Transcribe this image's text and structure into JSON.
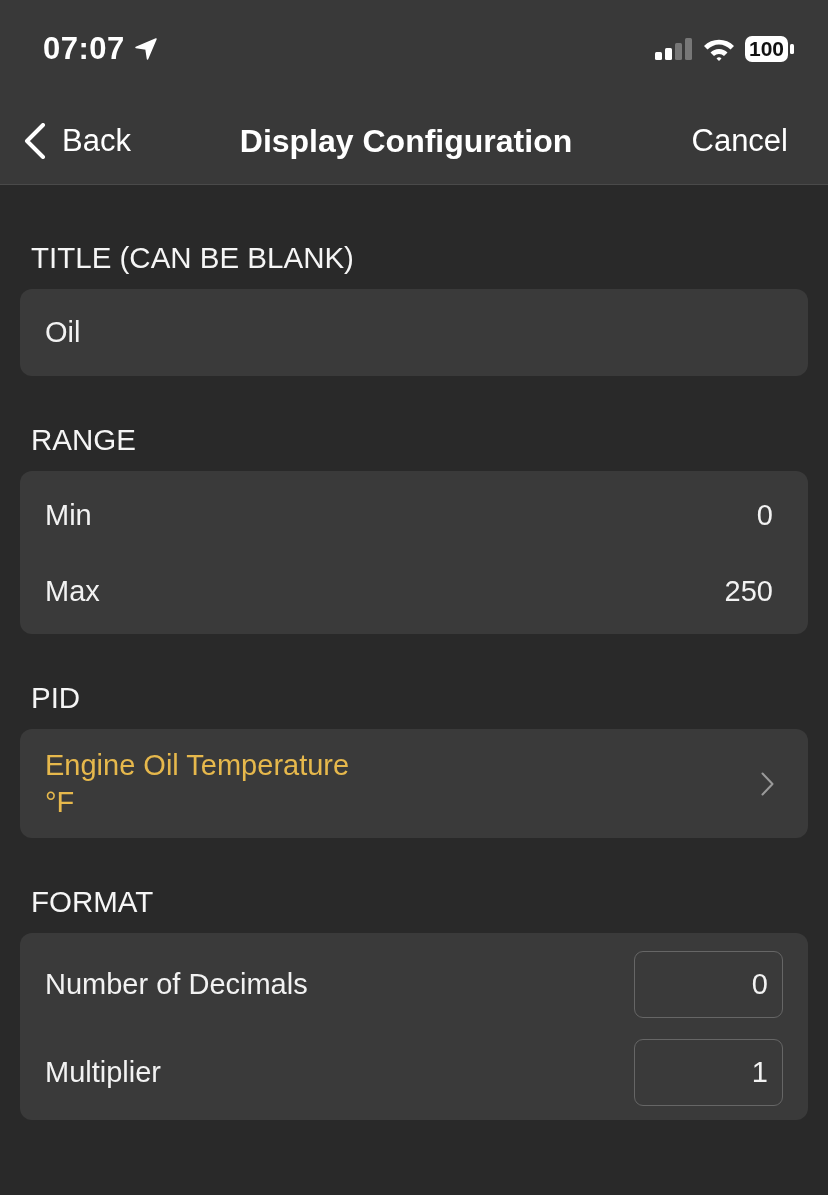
{
  "status_bar": {
    "time": "07:07",
    "battery": "100"
  },
  "nav": {
    "back": "Back",
    "title": "Display Configuration",
    "cancel": "Cancel"
  },
  "sections": [
    {
      "header": "TITLE (CAN BE BLANK)",
      "kind": "text",
      "value": "Oil"
    },
    {
      "header": "RANGE",
      "kind": "pairs",
      "rows": [
        {
          "label": "Min",
          "value": "0"
        },
        {
          "label": "Max",
          "value": "250"
        }
      ]
    },
    {
      "header": "PID",
      "kind": "link",
      "lines": [
        "Engine Oil Temperature",
        "°F"
      ]
    },
    {
      "header": "FORMAT",
      "kind": "inputs",
      "rows": [
        {
          "label": "Number of Decimals",
          "value": "0"
        },
        {
          "label": "Multiplier",
          "value": "1"
        }
      ]
    }
  ]
}
